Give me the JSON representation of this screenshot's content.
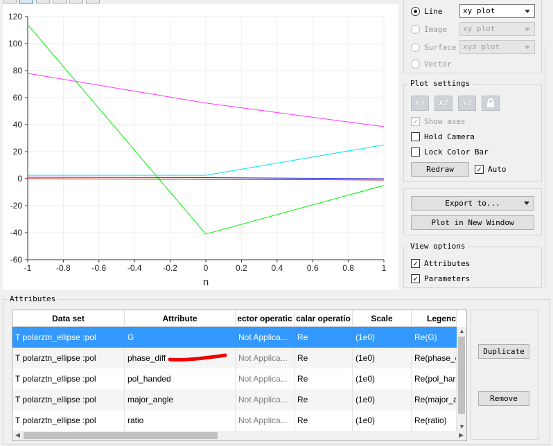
{
  "toolbar": {
    "buttons": [
      "home-icon",
      "zoom-icon",
      "pan-icon",
      "rotate-icon",
      "select-icon",
      "settings-icon"
    ]
  },
  "chart_data": {
    "type": "line",
    "xlabel": "n",
    "ylabel": "",
    "xlim": [
      -1,
      1
    ],
    "ylim": [
      -60,
      120
    ],
    "xticks": [
      "-1",
      "-0.8",
      "-0.6",
      "-0.4",
      "-0.2",
      "0",
      "0.2",
      "0.4",
      "0.6",
      "0.8",
      "1"
    ],
    "yticks": [
      "120",
      "100",
      "80",
      "60",
      "40",
      "20",
      "0",
      "-20",
      "-40",
      "-60"
    ],
    "grid": true,
    "series": [
      {
        "color": "#00ee00",
        "x": [
          -1,
          0,
          1
        ],
        "y": [
          114,
          -41,
          -5
        ]
      },
      {
        "color": "#ff33ff",
        "x": [
          -1,
          0,
          1
        ],
        "y": [
          78,
          56,
          38.5
        ]
      },
      {
        "color": "#00e5e5",
        "x": [
          -1,
          0,
          1
        ],
        "y": [
          2.5,
          2.5,
          25
        ]
      },
      {
        "color": "#2222dd",
        "x": [
          -1,
          0,
          1
        ],
        "y": [
          1,
          0.8,
          0
        ]
      },
      {
        "color": "#cc1111",
        "x": [
          -1,
          0,
          1
        ],
        "y": [
          0,
          -0.5,
          -1
        ]
      }
    ]
  },
  "plot_type": {
    "options": [
      {
        "label": "Line",
        "selected": true,
        "enabled": true,
        "dropdown": "xy plot"
      },
      {
        "label": "Image",
        "selected": false,
        "enabled": false,
        "dropdown": "xy plot"
      },
      {
        "label": "Surface",
        "selected": false,
        "enabled": false,
        "dropdown": "xyz plot"
      },
      {
        "label": "Vector",
        "selected": false,
        "enabled": false,
        "dropdown": ""
      }
    ]
  },
  "plot_settings": {
    "title": "Plot settings",
    "view_buttons": [
      "XY",
      "XZ",
      "YZ"
    ],
    "show_axes": "Show axes",
    "hold_camera": "Hold Camera",
    "lock_color_bar": "Lock Color Bar",
    "redraw": "Redraw",
    "auto": "Auto"
  },
  "export": {
    "export_to": "Export to...",
    "plot_new_window": "Plot in New Window"
  },
  "view_options": {
    "title": "View options",
    "attributes": "Attributes",
    "parameters": "Parameters"
  },
  "attributes": {
    "title": "Attributes",
    "columns": [
      "Data set",
      "Attribute",
      "ector operatic",
      "calar operatio",
      "Scale",
      "Legenc"
    ],
    "rows": [
      [
        "T polarztn_ellipse :pol",
        "G",
        "Not Applica...",
        "Re",
        "(1e0)",
        "Re(G)"
      ],
      [
        "T polarztn_ellipse :pol",
        "phase_diff",
        "Not Applica...",
        "Re",
        "(1e0)",
        "Re(phase_c"
      ],
      [
        "T polarztn_ellipse :pol",
        "pol_handed",
        "Not Applica...",
        "Re",
        "(1e0)",
        "Re(pol_har"
      ],
      [
        "T polarztn_ellipse :pol",
        "major_angle",
        "Not Applica...",
        "Re",
        "(1e0)",
        "Re(major_a"
      ],
      [
        "T polarztn_ellipse :pol",
        "ratio",
        "Not Applica...",
        "Re",
        "(1e0)",
        "Re(ratio)"
      ]
    ],
    "duplicate": "Duplicate",
    "remove": "Remove"
  }
}
